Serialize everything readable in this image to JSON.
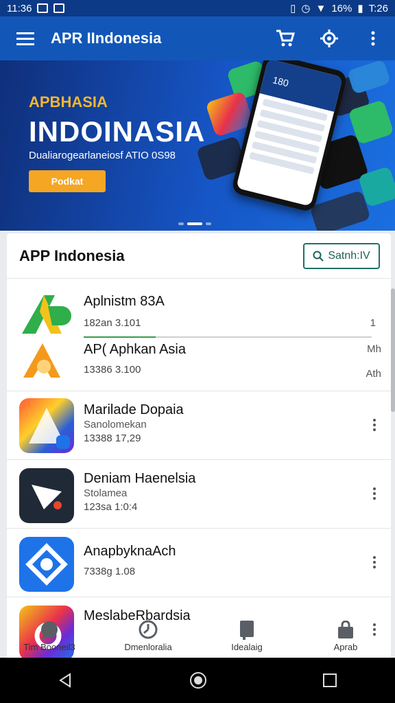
{
  "status_bar": {
    "time_left": "11:36",
    "battery": "16%",
    "time_right": "T:26"
  },
  "app_bar": {
    "title": "APR IIndonesia"
  },
  "banner": {
    "kicker": "APBHASIA",
    "headline": "INDOINASIA",
    "subtitle": "Dualiarogearlaneiosf ATIO 0S98",
    "button_label": "Podkat",
    "phone_text": "180"
  },
  "section": {
    "title": "APP Indonesia",
    "search_label": "Satnh:IV"
  },
  "apps": [
    {
      "name": "Aplnistm 83A",
      "meta": "182an 3.101",
      "right": "1"
    },
    {
      "name": "AP( Aphkan Asia",
      "meta": "13386 3.100",
      "right_top": "Mh",
      "right_bottom": "Ath"
    },
    {
      "name": "Marilade Dopaia",
      "sub": "Sanolomekan",
      "meta": "13388 17,29"
    },
    {
      "name": "Deniam Haenelsia",
      "sub": "Stolamea",
      "meta": "123sa 1:0:4"
    },
    {
      "name": "AnapbyknaAch",
      "meta": "7338g 1.08"
    },
    {
      "name": "MeslabeRbardsia"
    }
  ],
  "bottom_nav": [
    {
      "label": "Tim Booneil3",
      "icon": "chat-icon"
    },
    {
      "label": "Dmenloralia",
      "icon": "clock-icon"
    },
    {
      "label": "Idealaig",
      "icon": "book-icon"
    },
    {
      "label": "Aprab",
      "icon": "bag-icon"
    }
  ],
  "colors": {
    "primary": "#1257b8",
    "accent": "#f5a623",
    "search_border": "#1f6f6a"
  }
}
